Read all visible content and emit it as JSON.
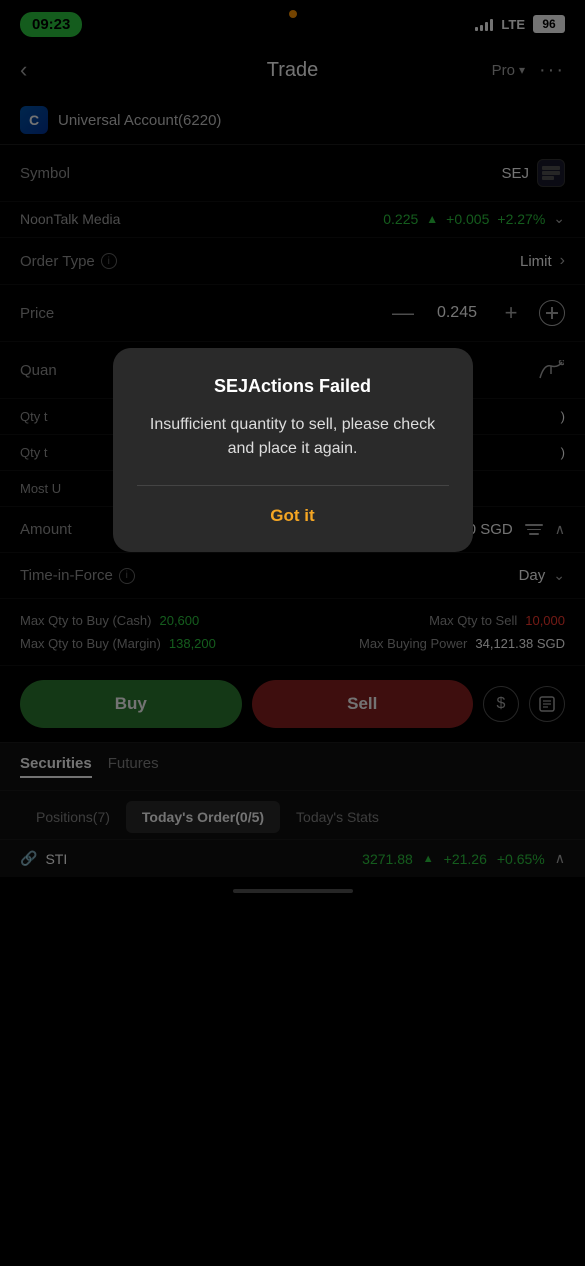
{
  "statusBar": {
    "time": "09:23",
    "lte": "LTE",
    "battery": "96"
  },
  "header": {
    "title": "Trade",
    "proLabel": "Pro",
    "backIcon": "‹",
    "moreIcon": "···"
  },
  "account": {
    "name": "Universal Account(6220)",
    "icon": "C"
  },
  "symbol": {
    "label": "Symbol",
    "value": "SEJ"
  },
  "ticker": {
    "name": "NoonTalk Media",
    "price": "0.225",
    "change": "+0.005",
    "pct": "+2.27%"
  },
  "orderType": {
    "label": "Order Type",
    "value": "Limit"
  },
  "price": {
    "label": "Price",
    "value": "0.245"
  },
  "quantity": {
    "label": "Quan"
  },
  "qtyToBuy": {
    "label": "Qty t",
    "value": ""
  },
  "qtyToSell": {
    "label": "Qty t",
    "value": ""
  },
  "mostU": {
    "label": "Most U",
    "value": ""
  },
  "amount": {
    "label": "Amount",
    "value": "2,450.00 SGD"
  },
  "timeInForce": {
    "label": "Time-in-Force",
    "value": "Day"
  },
  "maxQtyBuyCash": {
    "label": "Max Qty to Buy (Cash)",
    "value": "20,600"
  },
  "maxQtyBuyMargin": {
    "label": "Max Qty to Buy (Margin)",
    "value": "138,200"
  },
  "maxQtyToSell": {
    "label": "Max Qty to Sell",
    "value": "10,000"
  },
  "maxBuyingPower": {
    "label": "Max Buying Power",
    "value": "34,121.38 SGD"
  },
  "buttons": {
    "buy": "Buy",
    "sell": "Sell"
  },
  "tabs": {
    "securities": "Securities",
    "futures": "Futures"
  },
  "bottomTabs": {
    "positions": "Positions(7)",
    "todayOrder": "Today's Order(0/5)",
    "todayStats": "Today's Stats"
  },
  "tickerBottom": {
    "symbol": "STI",
    "price": "3271.88",
    "change": "+21.26",
    "pct": "+0.65%"
  },
  "modal": {
    "title": "SEJActions Failed",
    "body": "Insufficient quantity to sell, please check and place it again.",
    "button": "Got it"
  }
}
